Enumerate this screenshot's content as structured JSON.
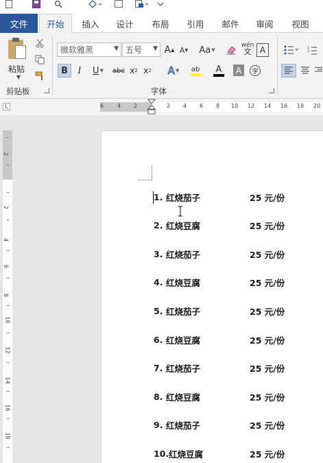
{
  "quick_access": {
    "icons": [
      "new-document-icon",
      "save-icon",
      "preview-icon",
      "format-painter-icon",
      "picture-icon",
      "customize-icon"
    ]
  },
  "tabs": {
    "file": "文件",
    "items": [
      "开始",
      "插入",
      "设计",
      "布局",
      "引用",
      "邮件",
      "审阅",
      "视图"
    ],
    "active": "开始"
  },
  "ribbon": {
    "clipboard": {
      "paste_label": "粘贴",
      "group_label": "剪贴板"
    },
    "font": {
      "font_name": "微软雅黑",
      "font_size": "五号",
      "grow_label": "A",
      "shrink_label": "A",
      "case_label": "Aa",
      "phonetic_label": "wén",
      "bold_label": "B",
      "italic_label": "I",
      "underline_label": "U",
      "strike_label": "abc",
      "sub_label": "x",
      "sub_suffix": "2",
      "sup_label": "x",
      "sup_suffix": "2",
      "effect_label": "A",
      "highlight_label": "ab",
      "color_label": "A",
      "shade_label": "A",
      "enclose_label": "字",
      "group_label": "字体",
      "highlight_color": "#ffff00",
      "font_color": "#000000"
    }
  },
  "ruler": {
    "corner_label": "L",
    "ticks": [
      "6",
      "4",
      "2",
      "2",
      "4",
      "6",
      "8",
      "10",
      "12",
      "14",
      "16",
      "18",
      "20"
    ]
  },
  "vruler": {
    "ticks": [
      "2",
      "2",
      "4",
      "6",
      "8",
      "10",
      "12",
      "14",
      "16",
      "18"
    ]
  },
  "document": {
    "items": [
      {
        "num": "1.",
        "dish": "红烧茄子",
        "price": "25 元/份"
      },
      {
        "num": "2.",
        "dish": "红烧豆腐",
        "price": "25 元/份"
      },
      {
        "num": "3.",
        "dish": "红烧茄子",
        "price": "25 元/份"
      },
      {
        "num": "4.",
        "dish": "红烧豆腐",
        "price": "25 元/份"
      },
      {
        "num": "5.",
        "dish": "红烧茄子",
        "price": "25 元/份"
      },
      {
        "num": "6.",
        "dish": "红烧豆腐",
        "price": "25 元/份"
      },
      {
        "num": "7.",
        "dish": "红烧茄子",
        "price": "25 元/份"
      },
      {
        "num": "8.",
        "dish": "红烧豆腐",
        "price": "25 元/份"
      },
      {
        "num": "9.",
        "dish": "红烧茄子",
        "price": "25 元/份"
      },
      {
        "num": "10.",
        "dish": "红烧豆腐",
        "price": "25 元/份"
      }
    ]
  },
  "colors": {
    "file_tab": "#2b579a",
    "active_tab_text": "#2b579a",
    "ribbon_bg": "#f3f3f3",
    "pressed_button": "#c5d3e8"
  }
}
